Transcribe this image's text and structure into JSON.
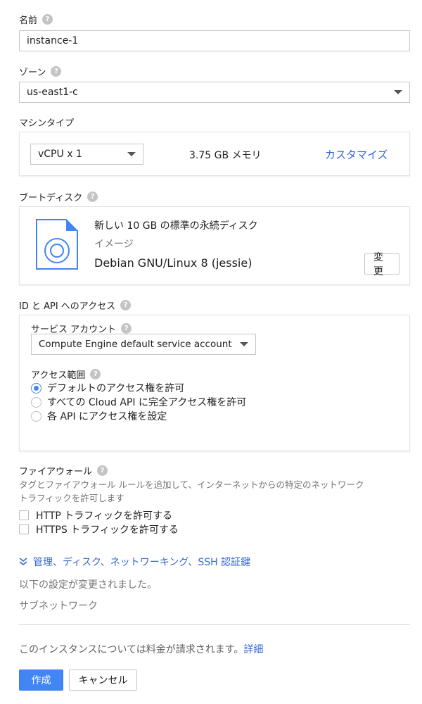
{
  "name": {
    "label": "名前",
    "value": "instance-1"
  },
  "zone": {
    "label": "ゾーン",
    "selected": "us-east1-c"
  },
  "machine_type": {
    "label": "マシンタイプ",
    "vcpu_selected": "vCPU x 1",
    "memory": "3.75 GB メモリ",
    "customize_link": "カスタマイズ"
  },
  "boot_disk": {
    "label": "ブートディスク",
    "description": "新しい 10 GB の標準の永続ディスク",
    "image_label": "イメージ",
    "image_value": "Debian GNU/Linux 8 (jessie)",
    "change_button": "変更"
  },
  "identity": {
    "label": "ID と API へのアクセス",
    "service_account_label": "サービス アカウント",
    "service_account_selected": "Compute Engine default service account",
    "access_scope_label": "アクセス範囲",
    "options": [
      {
        "label": "デフォルトのアクセス権を許可",
        "selected": true
      },
      {
        "label": "すべての Cloud API に完全アクセス権を許可",
        "selected": false
      },
      {
        "label": "各 API にアクセス権を設定",
        "selected": false
      }
    ]
  },
  "firewall": {
    "label": "ファイアウォール",
    "description_line1": "タグとファイアウォール ルールを追加して、インターネットからの特定のネットワーク",
    "description_line2": "トラフィックを許可します",
    "http": "HTTP トラフィックを許可する",
    "https": "HTTPS トラフィックを許可する"
  },
  "advanced": {
    "expand_link": "管理、ディスク、ネットワーキング、SSH 認証鍵",
    "changed_notice": "以下の設定が変更されました。",
    "subnetwork": "サブネットワーク"
  },
  "billing": {
    "notice": "このインスタンスについては料金が請求されます。",
    "details_link": "詳細"
  },
  "actions": {
    "create": "作成",
    "cancel": "キャンセル"
  },
  "colors": {
    "accent": "#4285f4",
    "link": "#3367d6",
    "muted": "#757575"
  }
}
